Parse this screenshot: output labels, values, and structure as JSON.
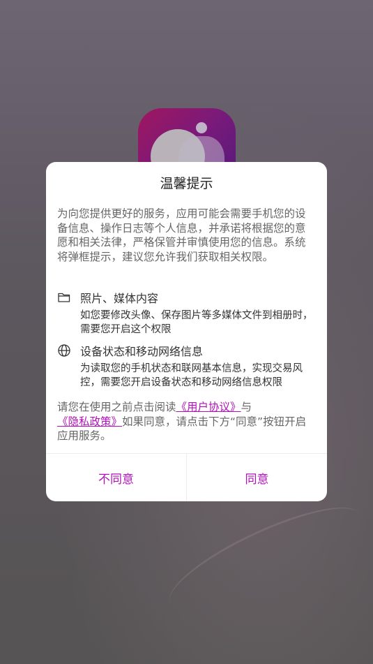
{
  "dialog": {
    "title": "温馨提示",
    "intro": "为向您提供更好的服务，应用可能会需要手机您的设备信息、操作日志等个人信息，并承诺将根据您的意愿和相关法律，严格保管并审慎使用您的信息。系统将弹框提示，建议您允许我们获取相关权限。",
    "permissions": [
      {
        "icon": "folder-icon",
        "title": "照片、媒体内容",
        "desc": "如您要修改头像、保存图片等多媒体文件到相册时，需要您开启这个权限"
      },
      {
        "icon": "globe-icon",
        "title": "设备状态和移动网络信息",
        "desc": "为读取您的手机状态和联网基本信息，实现交易风控，需要您开启设备状态和移动网络信息权限"
      }
    ],
    "agreement": {
      "prefix": "请您在使用之前点击阅读",
      "user_agreement": "《用户协议》",
      "and": "与",
      "privacy_policy": "《隐私政策》",
      "suffix": "如果同意，请点击下方“同意”按钮开启应用服务。"
    },
    "buttons": {
      "disagree": "不同意",
      "agree": "同意"
    },
    "accent_color": "#b012b8"
  },
  "background": {
    "logo": "app-logo-icon"
  }
}
